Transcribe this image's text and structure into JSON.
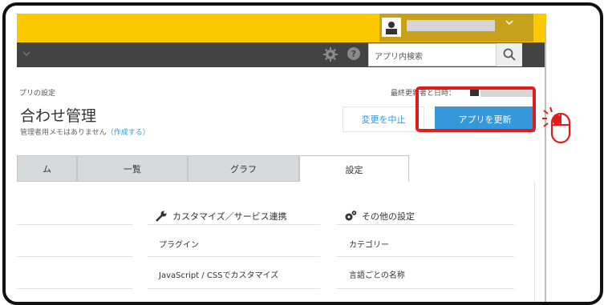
{
  "header": {
    "search_placeholder": "アプリ内検索"
  },
  "breadcrumb": "プリの設定",
  "last_updated_label": "最終更新者と日時：",
  "page": {
    "title": "合わせ管理",
    "memo_text": "管理者用メモはありません",
    "memo_link": "（作成する）"
  },
  "actions": {
    "cancel_label": "変更を中止",
    "update_label": "アプリを更新"
  },
  "tabs": [
    {
      "label": "ム"
    },
    {
      "label": "一覧"
    },
    {
      "label": "グラフ"
    },
    {
      "label": "設定"
    }
  ],
  "sections": {
    "customize": {
      "title": "カスタマイズ／サービス連携",
      "items": [
        "プラグイン",
        "JavaScript / CSSでカスタマイズ"
      ]
    },
    "other": {
      "title": "その他の設定",
      "items": [
        "カテゴリー",
        "言語ごとの名称"
      ]
    }
  },
  "colors": {
    "topbar": "#fcc800",
    "darkbar": "#434343",
    "accent": "#3498db",
    "highlight": "#e21b1b"
  },
  "icons": {
    "settings": "gear-icon",
    "help": "help-icon",
    "search": "search-icon",
    "cursor": "mouse-click-icon"
  }
}
